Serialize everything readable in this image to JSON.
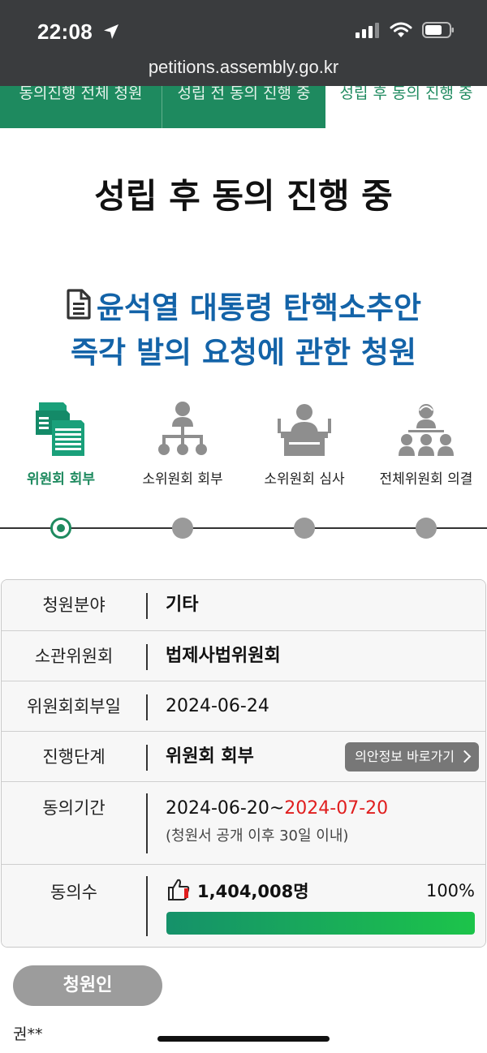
{
  "status_bar": {
    "time": "22:08",
    "icons": [
      "location-arrow-icon",
      "signal-icon",
      "wifi-icon",
      "battery-icon"
    ],
    "url": "petitions.assembly.go.kr"
  },
  "tabs": [
    {
      "label": "동의진행 전체 청원"
    },
    {
      "label": "성립 전 동의 진행 중"
    },
    {
      "label": "성립 후 동의 진행 중",
      "active": true
    }
  ],
  "page_title": "성립 후 동의 진행 중",
  "petition_title": {
    "icon": "document-icon",
    "line1": "윤석열 대통령 탄핵소추안",
    "line2": "즉각 발의 요청에 관한 청원"
  },
  "steps": [
    {
      "label": "위원회 회부",
      "icon": "stacked-documents-icon",
      "active": true
    },
    {
      "label": "소위원회 회부",
      "icon": "org-chart-icon"
    },
    {
      "label": "소위원회 심사",
      "icon": "podium-speaker-icon"
    },
    {
      "label": "전체위원회 의결",
      "icon": "group-people-icon"
    }
  ],
  "info": {
    "field_label": "청원분야",
    "field_value": "기타",
    "committee_label": "소관위원회",
    "committee_value": "법제사법위원회",
    "referral_date_label": "위원회회부일",
    "referral_date_value": "2024-06-24",
    "stage_label": "진행단계",
    "stage_value": "위원회 회부",
    "bill_info_button": "의안정보 바로가기",
    "period_label": "동의기간",
    "period_start": "2024-06-20",
    "period_separator": "~",
    "period_end": "2024-07-20",
    "period_note": "(청원서 공개 이후 30일 이내)",
    "agree_label": "동의수",
    "agree_count": "1,404,008명",
    "agree_percent_text": "100%",
    "agree_fraction": 1.0
  },
  "colors": {
    "brand_green": "#1e8a5f",
    "title_blue": "#1363a8",
    "deadline_red": "#e01e1e"
  },
  "petitioner": {
    "button_label": "청원인",
    "name": "권**"
  }
}
